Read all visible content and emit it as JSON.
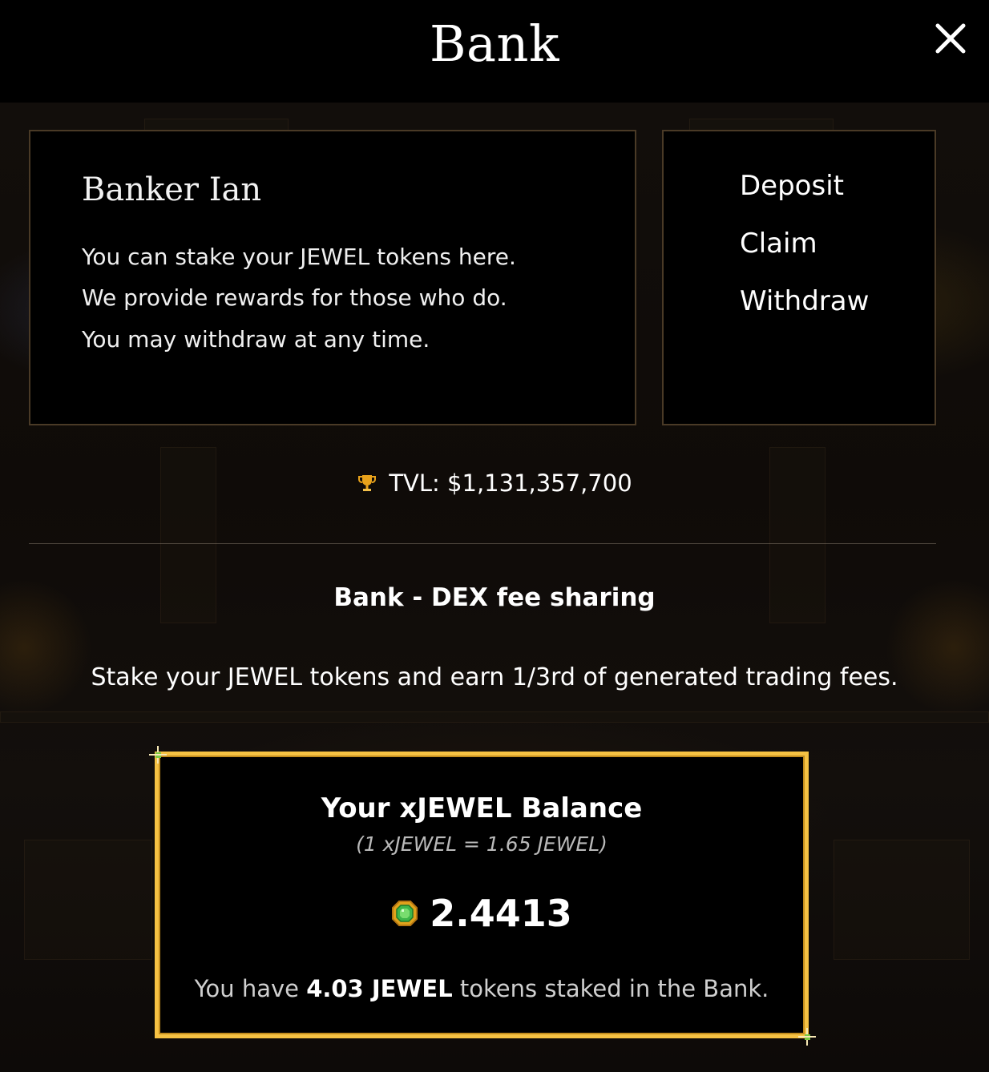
{
  "header": {
    "title": "Bank"
  },
  "npc": {
    "name": "Banker Ian",
    "lines": [
      "You can stake your JEWEL tokens here.",
      "We provide rewards for those who do.",
      "You may withdraw at any time."
    ]
  },
  "menu": {
    "items": [
      "Deposit",
      "Claim",
      "Withdraw"
    ]
  },
  "tvl": {
    "text": "TVL: $1,131,357,700"
  },
  "section": {
    "title": "Bank - DEX fee sharing",
    "description": "Stake your JEWEL tokens and earn 1/3rd of generated trading fees."
  },
  "balance": {
    "title": "Your xJEWEL Balance",
    "rate": "(1 xJEWEL = 1.65 JEWEL)",
    "amount": "2.4413",
    "staked_prefix": "You have ",
    "staked_amount": "4.03 JEWEL",
    "staked_suffix": " tokens staked in the Bank."
  },
  "icons": {
    "close": "close-icon",
    "trophy": "trophy-icon",
    "jewel": "jewel-token-icon"
  },
  "colors": {
    "background": "#000000",
    "panel_border": "#4a3a26",
    "balance_border": "#f6c243",
    "text": "#ffffff",
    "muted_text": "#b9b9b9",
    "jewel_green": "#3fb64a"
  }
}
